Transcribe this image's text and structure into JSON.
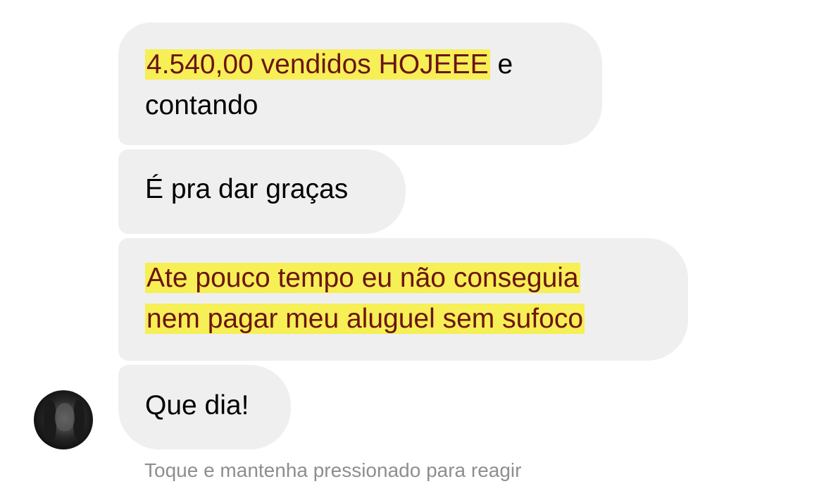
{
  "messages": [
    {
      "segments": {
        "line1_highlight": "4.540,00 vendidos HOJEEE",
        "line1_rest": " e",
        "line2": "contando"
      }
    },
    {
      "text": "É pra dar graças"
    },
    {
      "line1": "Ate pouco tempo eu não conseguia",
      "line2": "nem pagar meu aluguel sem sufoco"
    },
    {
      "text": "Que dia!"
    }
  ],
  "hint": "Toque e mantenha pressionado para reagir",
  "colors": {
    "bubble_bg": "#efefef",
    "highlight_bg": "#f6ef55",
    "highlight_text": "#6b1414",
    "hint_text": "#8e8e8e"
  },
  "avatar_icon": "user-avatar-photo"
}
